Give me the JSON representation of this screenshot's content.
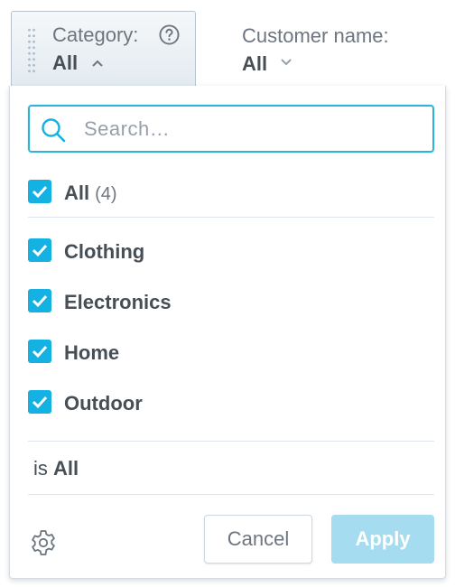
{
  "filters": {
    "category": {
      "label": "Category:",
      "value": "All"
    },
    "customer": {
      "label": "Customer name:",
      "value": "All"
    }
  },
  "dropdown": {
    "search": {
      "placeholder": "Search…",
      "value": ""
    },
    "all_option": {
      "label": "All",
      "count": "(4)",
      "checked": true
    },
    "options": [
      {
        "label": "Clothing",
        "checked": true
      },
      {
        "label": "Electronics",
        "checked": true
      },
      {
        "label": "Home",
        "checked": true
      },
      {
        "label": "Outdoor",
        "checked": true
      }
    ],
    "summary": {
      "prefix": "is",
      "value": "All"
    },
    "buttons": {
      "cancel": "Cancel",
      "apply": "Apply"
    }
  },
  "colors": {
    "accent": "#14b2e2",
    "search_border": "#31b4dc",
    "apply_disabled": "#a6dcf0",
    "text": "#464e56",
    "muted": "#6d7680"
  },
  "icons": [
    "drag-handle-icon",
    "help-icon",
    "chevron-up-icon",
    "chevron-down-icon",
    "search-icon",
    "checkbox-checked-icon",
    "gear-icon"
  ]
}
